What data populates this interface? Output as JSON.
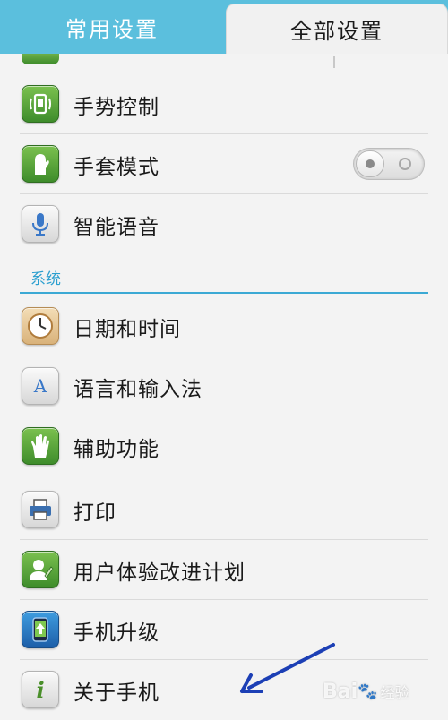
{
  "tabs": [
    {
      "label": "常用设置",
      "active": false
    },
    {
      "label": "全部设置",
      "active": true
    }
  ],
  "items_top": [
    {
      "label": "手势控制",
      "icon": "gesture-icon"
    },
    {
      "label": "手套模式",
      "icon": "glove-icon",
      "toggle": false
    },
    {
      "label": "智能语音",
      "icon": "microphone-icon"
    }
  ],
  "section": {
    "title": "系统"
  },
  "items_system": [
    {
      "label": "日期和时间",
      "icon": "clock-icon"
    },
    {
      "label": "语言和输入法",
      "icon": "language-icon"
    },
    {
      "label": "辅助功能",
      "icon": "hand-icon"
    },
    {
      "label": "打印",
      "icon": "printer-icon"
    },
    {
      "label": "用户体验改进计划",
      "icon": "user-experience-icon"
    },
    {
      "label": "手机升级",
      "icon": "phone-upgrade-icon"
    },
    {
      "label": "关于手机",
      "icon": "info-icon"
    }
  ],
  "watermark": {
    "brand": "Bai",
    "sub": "经验"
  },
  "colors": {
    "tabbar": "#5bbfdd",
    "section_accent": "#2b9fcf",
    "arrow": "#1c3fb5"
  }
}
